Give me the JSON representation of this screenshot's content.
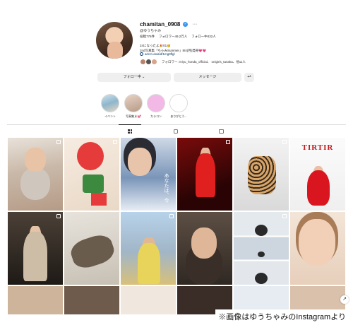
{
  "profile": {
    "username": "chamitan_0908",
    "name": "ゆうちゃみ",
    "stats": {
      "posts": "投稿776件",
      "followers": "フォロワー49.2万人",
      "following": "フォロー中432人"
    },
    "bio": [
      "24になったよ🎉01🥳",
      "2nd写真集「ちゃみSummer」8/4(月)発売💗💗"
    ],
    "link": "amzn.asia/d/1mg9flgl",
    "followed_by": "フォロワー: miyu_honda_official、 onigiris_tanaka、他11人",
    "more_icon": "ellipsis-icon",
    "verified_icon": "verified-check-icon"
  },
  "actions": {
    "follow": "フォロー中 ⌄",
    "message": "メッセージ",
    "suggest": "+ᴬ"
  },
  "highlights": [
    {
      "label": "イベント",
      "color": "#8fb6cc"
    },
    {
      "label": "写真集🎉💕",
      "color": "#b69a88"
    },
    {
      "label": "カラコン",
      "color": "#f3b9e6"
    },
    {
      "label": "ありがとう...",
      "color": "#ffffff"
    }
  ],
  "tabs": {
    "posts_icon": "grid-icon",
    "reels_icon": "reels-icon",
    "tagged_icon": "tagged-icon"
  },
  "posts": [
    {
      "id": 1,
      "text": ""
    },
    {
      "id": 2,
      "text": ""
    },
    {
      "id": 3,
      "text": "あなたは、今"
    },
    {
      "id": 4,
      "text": ""
    },
    {
      "id": 5,
      "text": ""
    },
    {
      "id": 6,
      "text": "TIRTIR"
    },
    {
      "id": 7,
      "text": ""
    },
    {
      "id": 8,
      "text": ""
    },
    {
      "id": 9,
      "text": ""
    },
    {
      "id": 10,
      "text": ""
    },
    {
      "id": 11,
      "text": ""
    },
    {
      "id": 12,
      "text": ""
    }
  ],
  "caption": "※画像はゆうちゃみのInstagramより",
  "colors": {
    "verified": "#3897f0",
    "link": "#00376b",
    "button_bg": "#efefef"
  }
}
